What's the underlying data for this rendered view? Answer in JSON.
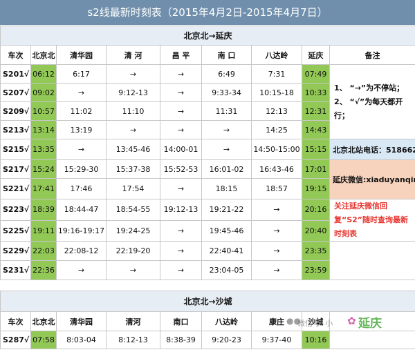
{
  "title": "s2线最新时刻表（2015年4月2日-2015年4月7日）",
  "section1": {
    "title": "北京北→延庆",
    "headers": [
      "车次",
      "北京北",
      "清华园",
      "清 河",
      "昌 平",
      "南 口",
      "八达岭",
      "延庆",
      "备注"
    ],
    "rows": [
      [
        "S201√",
        "06:12",
        "6:17",
        "→",
        "→",
        "6:49",
        "7:31",
        "07:49"
      ],
      [
        "S207√",
        "09:02",
        "→",
        "9:12-13",
        "→",
        "9:33-34",
        "10:15-18",
        "10:33"
      ],
      [
        "S209√",
        "10:57",
        "11:02",
        "11:10",
        "→",
        "11:31",
        "12:13",
        "12:31"
      ],
      [
        "S213√",
        "13:14",
        "13:19",
        "→",
        "→",
        "→",
        "14:25",
        "14:43"
      ],
      [
        "S215√",
        "13:35",
        "→",
        "13:45-46",
        "14:00-01",
        "→",
        "14:50-15:00",
        "15:15"
      ],
      [
        "S217√",
        "15:24",
        "15:29-30",
        "15:37-38",
        "15:52-53",
        "16:01-02",
        "16:43-46",
        "17:01"
      ],
      [
        "S221√",
        "17:41",
        "17:46",
        "17:54",
        "→",
        "18:15",
        "18:57",
        "19:15"
      ],
      [
        "S223√",
        "18:39",
        "18:44-47",
        "18:54-55",
        "19:12-13",
        "19:21-22",
        "→",
        "20:16"
      ],
      [
        "S225√",
        "19:11",
        "19:16-19:17",
        "19:24-25",
        "→",
        "19:45-46",
        "→",
        "20:40"
      ],
      [
        "S229√",
        "22:03",
        "22:08-12",
        "22:19-20",
        "→",
        "22:40-41",
        "→",
        "23:35"
      ],
      [
        "S231√",
        "22:36",
        "→",
        "→",
        "→",
        "23:04-05",
        "→",
        "23:59"
      ]
    ],
    "notes": {
      "legend_line1": "1、 “→”为不停站；",
      "legend_line2": "2、 “√”为每天都开行；",
      "phone": "北京北站电话：51866223",
      "wechat": "延庆微信:xiaduyanqing",
      "follow": "关注延庆微信回复“S2”随时查询最新时刻表"
    }
  },
  "section2": {
    "title": "北京北→沙城",
    "headers": [
      "车次",
      "北京北",
      "清华园",
      "清河",
      "南口",
      "八达岭",
      "康庄",
      "沙城"
    ],
    "rows": [
      [
        "S287√",
        "07:58",
        "8:03-04",
        "8:12-13",
        "8:38-39",
        "9:20-23",
        "9:37-40",
        "10:16"
      ]
    ]
  },
  "watermark": {
    "text": "微信号: 小",
    "logo": "延庆"
  },
  "colors": {
    "title_bg": "#6f8fac",
    "highlight_green": "#92c956",
    "section_bg": "#e7edf5",
    "note_blue": "#d9e8f5",
    "note_peach": "#f7d3bd",
    "note_red_text": "#e8352f"
  }
}
